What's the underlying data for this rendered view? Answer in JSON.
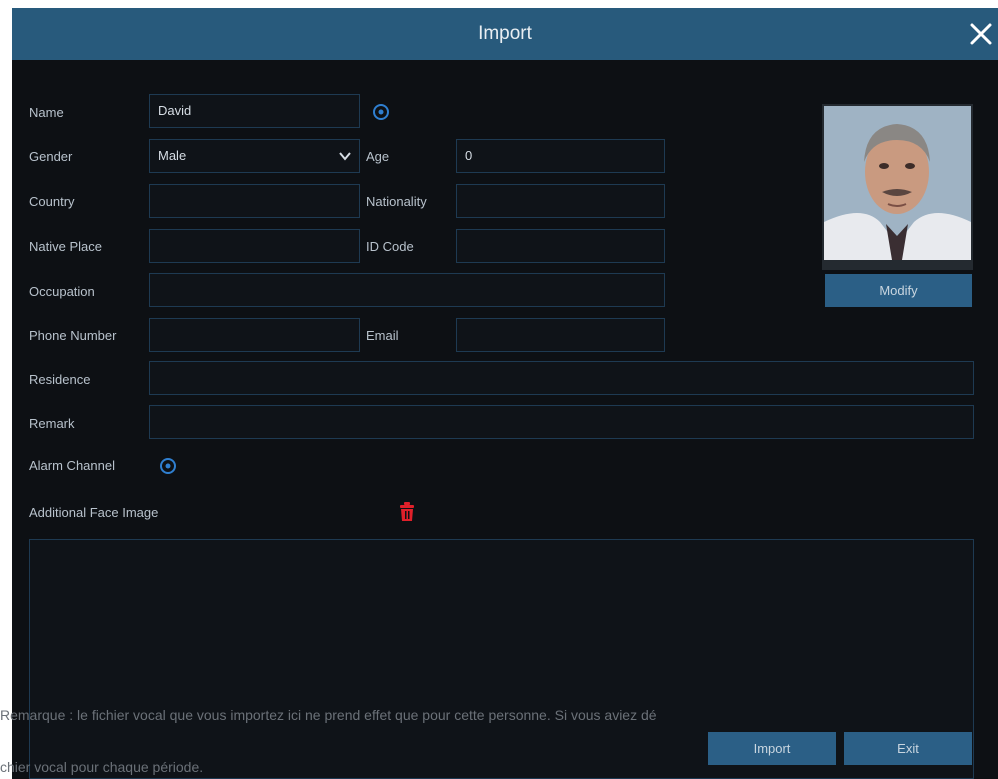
{
  "dialog": {
    "title": "Import",
    "close_icon": "close-icon"
  },
  "form": {
    "name": {
      "label": "Name",
      "value": "David"
    },
    "gender": {
      "label": "Gender",
      "value": "Male"
    },
    "age": {
      "label": "Age",
      "value": "0"
    },
    "country": {
      "label": "Country",
      "value": ""
    },
    "nationality": {
      "label": "Nationality",
      "value": ""
    },
    "native_place": {
      "label": "Native Place",
      "value": ""
    },
    "id_code": {
      "label": "ID Code",
      "value": ""
    },
    "occupation": {
      "label": "Occupation",
      "value": ""
    },
    "phone_number": {
      "label": "Phone Number",
      "value": ""
    },
    "email": {
      "label": "Email",
      "value": ""
    },
    "residence": {
      "label": "Residence",
      "value": ""
    },
    "remark": {
      "label": "Remark",
      "value": ""
    },
    "alarm_channel": {
      "label": "Alarm Channel"
    },
    "additional_face_image": {
      "label": "Additional Face Image"
    }
  },
  "photo": {
    "modify_label": "Modify"
  },
  "buttons": {
    "import_label": "Import",
    "exit_label": "Exit"
  },
  "overlay": {
    "line1": "Remarque : le fichier vocal que vous importez ici ne prend effet que pour cette personne. Si vous aviez dé",
    "line2": "chier vocal pour chaque période."
  },
  "colors": {
    "titlebar": "#285a7c",
    "dialog_bg": "#0d1014",
    "accent_button": "#2b5f86",
    "delete_icon": "#e0202a",
    "add_icon": "#2f7fd0"
  }
}
